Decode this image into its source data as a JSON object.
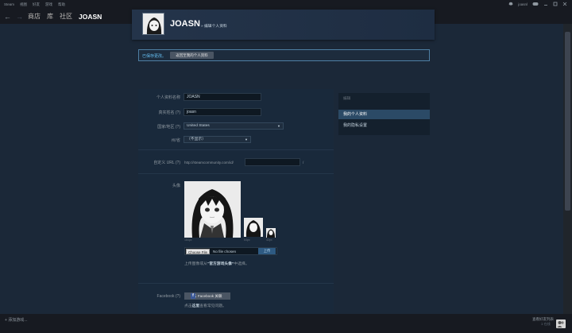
{
  "menubar": {
    "items": [
      "Steam",
      "视图",
      "好友",
      "游戏",
      "帮助"
    ],
    "username": "joasnl"
  },
  "nav": {
    "back": "←",
    "forward": "→",
    "links": [
      "商店",
      "库",
      "社区",
      "JOASN"
    ]
  },
  "profile_header": {
    "name": "JOASN",
    "subtitle": "» 编辑个人资料"
  },
  "notice": {
    "text": "已保存更改。",
    "button": "返回至我的个人资料"
  },
  "form": {
    "profile_name_label": "个人资料名称",
    "profile_name_value": "JOASN",
    "real_name_label": "真实姓名 (?)",
    "real_name_value": "joasn",
    "country_label": "国家/地区 (?)",
    "country_value": "United States",
    "state_label": "州/省",
    "state_value": "（不显示）",
    "custom_url_label": "自定义 URL (?)",
    "custom_url_prefix": "http://steamcommunity.com/id/",
    "custom_url_value": "",
    "custom_url_suffix": "/",
    "avatar_label": "头像",
    "avatar_sizes": [
      "184px",
      "64px",
      "32px"
    ],
    "choose_file": "Choose File",
    "no_file": "No file chosen",
    "upload": "上传",
    "avatar_hint_prefix": "上传图像或从",
    "avatar_hint_bold": "“官方游戏头像”",
    "avatar_hint_suffix": "中选择。",
    "facebook_label": "Facebook (?)",
    "facebook_button": "与 Facebook 关联",
    "facebook_hint_prefix": "点击",
    "facebook_hint_bold": "这里",
    "facebook_hint_suffix": "查看常见问题。"
  },
  "side_nav": {
    "title": "编辑",
    "items": [
      "我的个人资料",
      "我的隐私设置"
    ]
  },
  "bottom": {
    "add_game": "+  添加游戏...",
    "friends": "查看好友列表",
    "online": "1 在线"
  },
  "colors": {
    "background": "#1b2838",
    "accent": "#66c0f4",
    "active_nav": "#2b4a66"
  }
}
